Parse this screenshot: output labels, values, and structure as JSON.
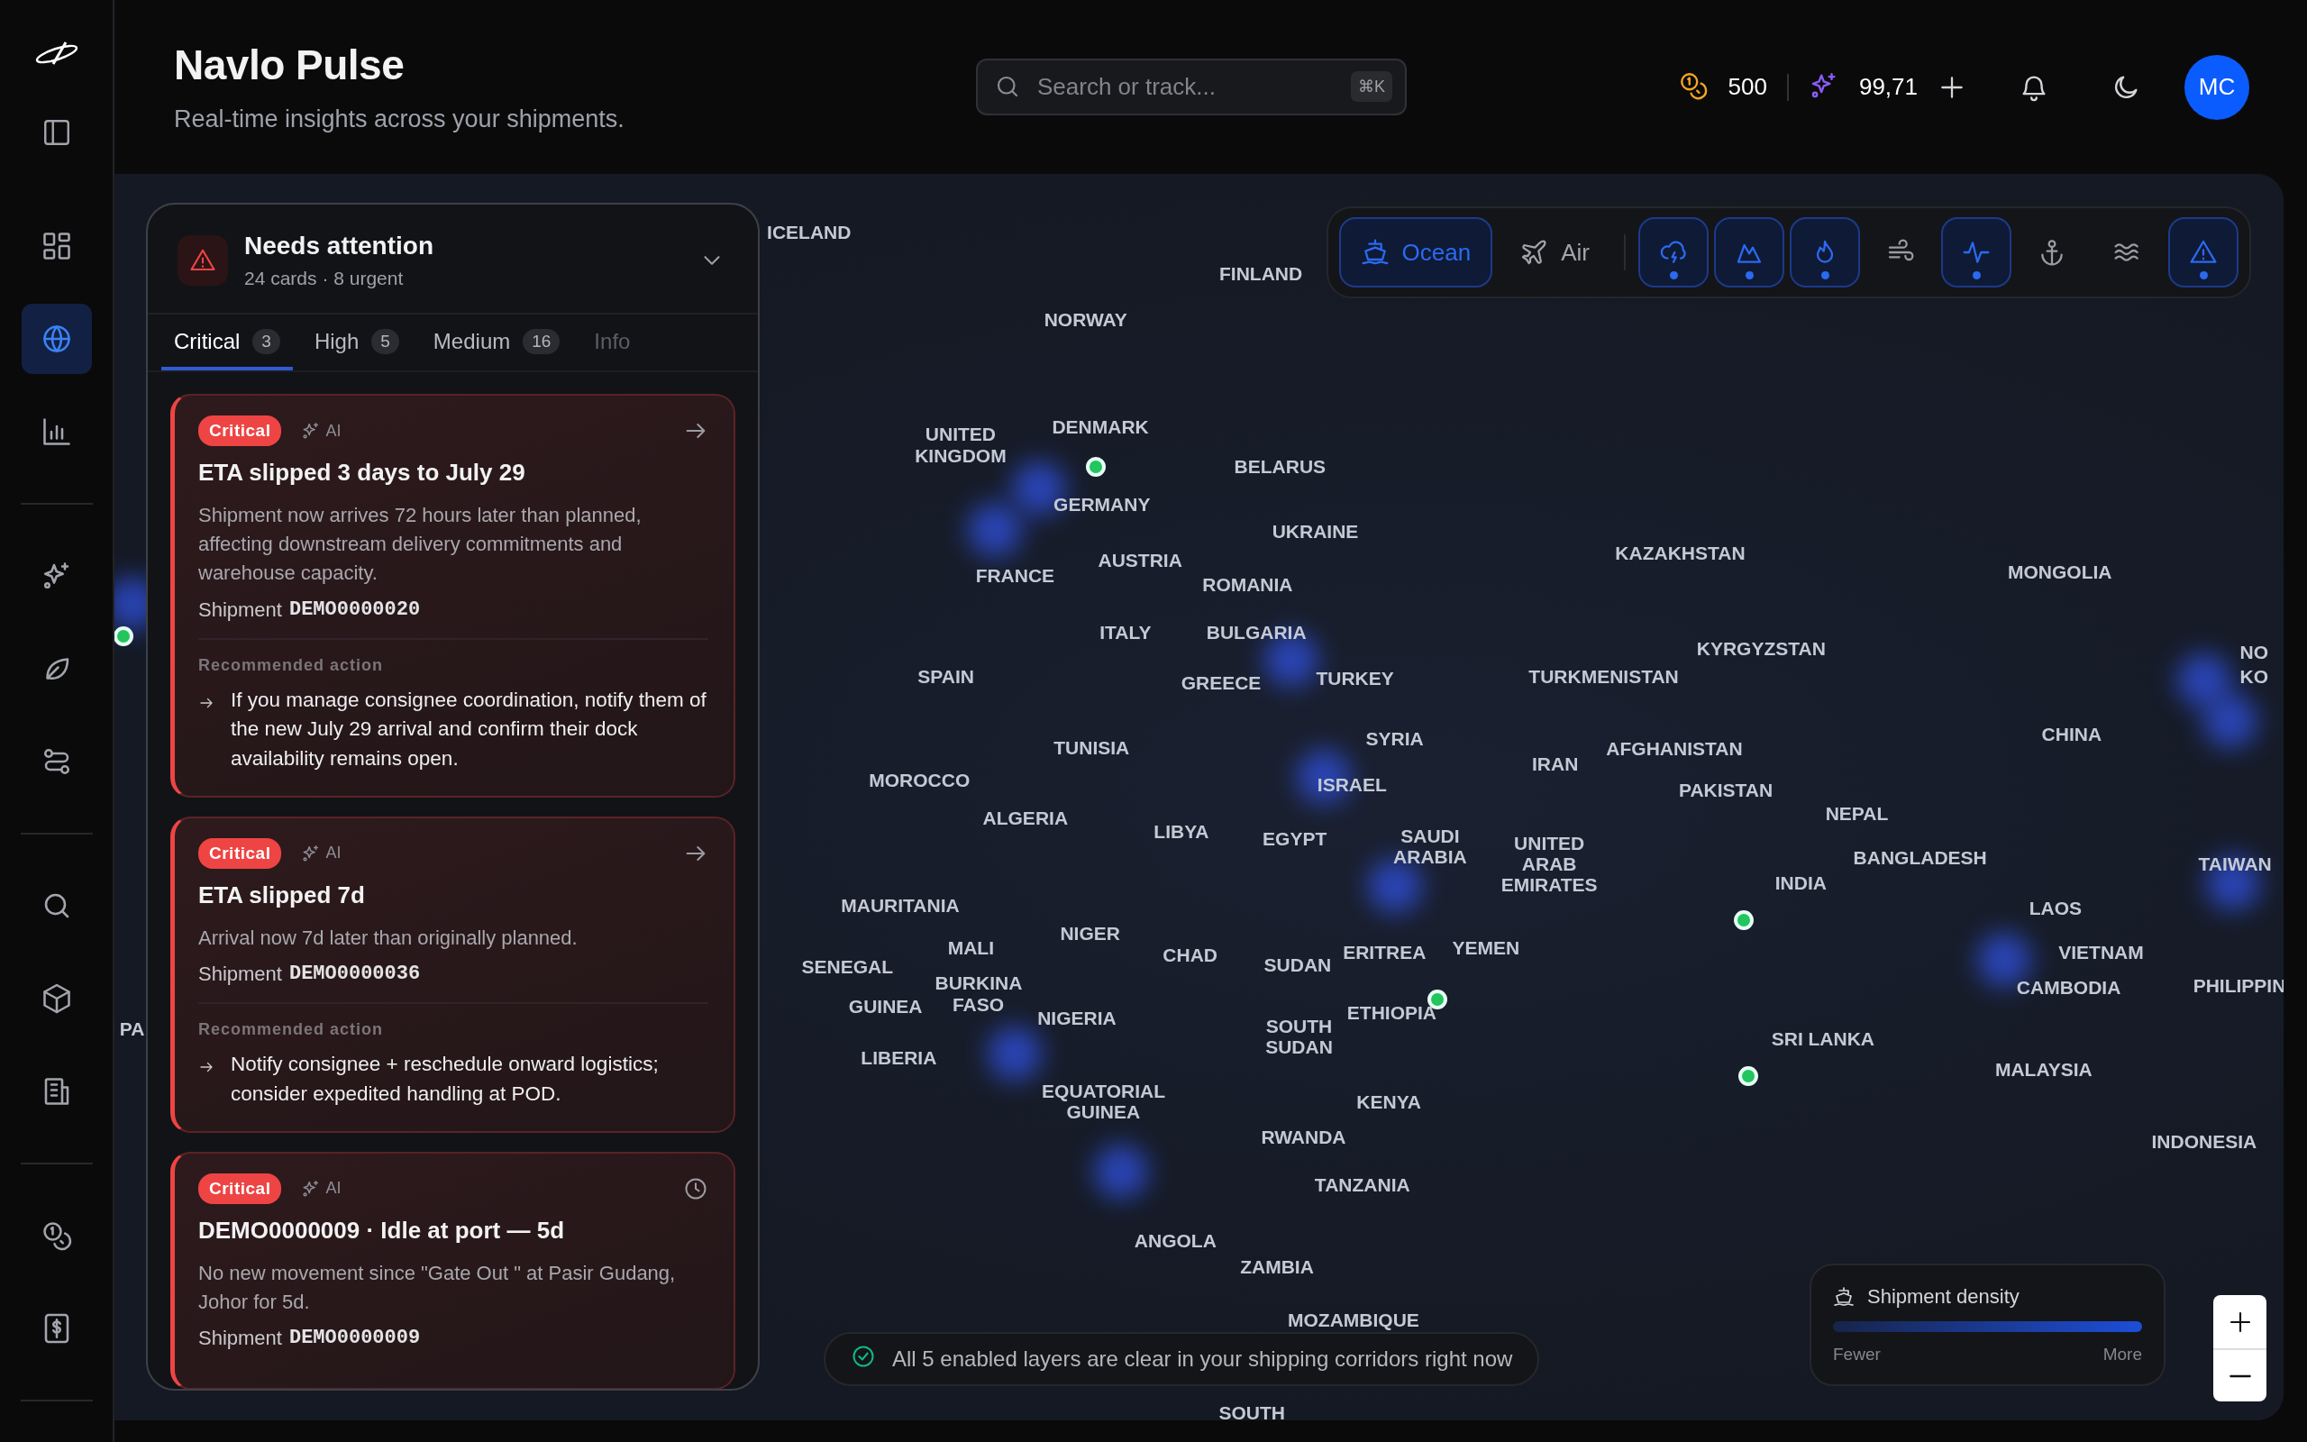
{
  "sidebar": {
    "groups": [
      {
        "items": [
          {
            "kind": "grid",
            "selected": false
          },
          {
            "kind": "globe",
            "selected": true
          },
          {
            "kind": "chart",
            "selected": false
          }
        ]
      },
      {
        "items": [
          {
            "kind": "sparkles",
            "selected": false
          },
          {
            "kind": "leaf",
            "selected": false
          },
          {
            "kind": "route",
            "selected": false
          }
        ]
      },
      {
        "items": [
          {
            "kind": "search",
            "selected": false
          },
          {
            "kind": "cube",
            "selected": false
          },
          {
            "kind": "building",
            "selected": false
          }
        ]
      },
      {
        "items": [
          {
            "kind": "coins",
            "selected": false
          },
          {
            "kind": "invoice",
            "selected": false
          }
        ]
      }
    ]
  },
  "header": {
    "title": "Navlo Pulse",
    "subtitle": "Real-time insights across your shipments.",
    "search": {
      "placeholder": "Search or track...",
      "shortcut": "⌘K"
    },
    "credits": "500",
    "points": "99,71",
    "avatar": "MC"
  },
  "attention": {
    "title": "Needs attention",
    "summary": "24 cards · 8 urgent",
    "tabs": [
      {
        "label": "Critical",
        "count": "3",
        "selected": true,
        "disabled": false
      },
      {
        "label": "High",
        "count": "5",
        "selected": false,
        "disabled": false
      },
      {
        "label": "Medium",
        "count": "16",
        "selected": false,
        "disabled": false
      },
      {
        "label": "Info",
        "selected": false,
        "disabled": true
      }
    ],
    "cards": [
      {
        "severity": "Critical",
        "ai": "AI",
        "kind": "arrow",
        "title": "ETA slipped 3 days to July 29",
        "body": "Shipment now arrives 72 hours later than planned, affecting downstream delivery commitments and warehouse capacity.",
        "shipment_label": "Shipment",
        "shipment_id": "DEMO0000020",
        "recommendation_label": "Recommended action",
        "recommendation": "If you manage consignee coordination, notify them of the new July 29 arrival and confirm their dock availability remains open."
      },
      {
        "severity": "Critical",
        "ai": "AI",
        "kind": "arrow",
        "title": "ETA slipped 7d",
        "body": "Arrival now 7d later than originally planned.",
        "shipment_label": "Shipment",
        "shipment_id": "DEMO0000036",
        "recommendation_label": "Recommended action",
        "recommendation": "Notify consignee + reschedule onward logistics; consider expedited handling at POD."
      },
      {
        "severity": "Critical",
        "ai": "AI",
        "kind": "clock",
        "title": "DEMO0000009 · Idle at port — 5d",
        "body": "No new movement since \"Gate Out \" at Pasir Gudang, Johor for 5d.",
        "shipment_label": "Shipment",
        "shipment_id": "DEMO0000009"
      }
    ]
  },
  "map": {
    "labels": [
      "ICELAND",
      "FINLAND",
      "NORWAY",
      "UNITED KINGDOM",
      "DENMARK",
      "BELARUS",
      "GERMANY",
      "UKRAINE",
      "FRANCE",
      "AUSTRIA",
      "ROMANIA",
      "KAZAKHSTAN",
      "MONGOLIA",
      "ITALY",
      "BULGARIA",
      "SPAIN",
      "GREECE",
      "TURKEY",
      "TURKMENISTAN",
      "KYRGYZSTAN",
      "CHINA",
      "TUNISIA",
      "SYRIA",
      "IRAN",
      "AFGHANISTAN",
      "MOROCCO",
      "ISRAEL",
      "PAKISTAN",
      "ALGERIA",
      "LIBYA",
      "EGYPT",
      "SAUDI ARABIA",
      "UNITED ARAB EMIRATES",
      "NEPAL",
      "BANGLADESH",
      "TAIWAN",
      "INDIA",
      "MAURITANIA",
      "NIGER",
      "MALI",
      "CHAD",
      "SUDAN",
      "ERITREA",
      "YEMEN",
      "LAOS",
      "VIETNAM",
      "SENEGAL",
      "GUINEA",
      "BURKINA FASO",
      "NIGERIA",
      "ETHIOPIA",
      "SOUTH SUDAN",
      "CAMBODIA",
      "PHILIPPIN",
      "SRI LANKA",
      "LIBERIA",
      "EQUATORIAL GUINEA",
      "KENYA",
      "MALAYSIA",
      "RWANDA",
      "INDONESIA",
      "TANZANIA",
      "ANGOLA",
      "ZAMBIA",
      "MOZAMBIQUE",
      "SOUTH",
      "NO",
      "KO",
      "PA"
    ],
    "modes": [
      {
        "kind": "ship",
        "label": "Ocean",
        "selected": true
      },
      {
        "kind": "plane",
        "label": "Air",
        "selected": false
      }
    ],
    "layers": [
      {
        "kind": "storm",
        "on": true
      },
      {
        "kind": "mountain",
        "on": true
      },
      {
        "kind": "flame",
        "on": true
      },
      {
        "kind": "wind",
        "on": false
      },
      {
        "kind": "pulse",
        "on": true
      },
      {
        "kind": "anchor",
        "on": false
      },
      {
        "kind": "waves",
        "on": false
      },
      {
        "kind": "alert",
        "on": true
      }
    ],
    "status": "All 5 enabled layers are clear in your shipping corridors right now",
    "density": {
      "title": "Shipment density",
      "low": "Fewer",
      "high": "More"
    }
  }
}
